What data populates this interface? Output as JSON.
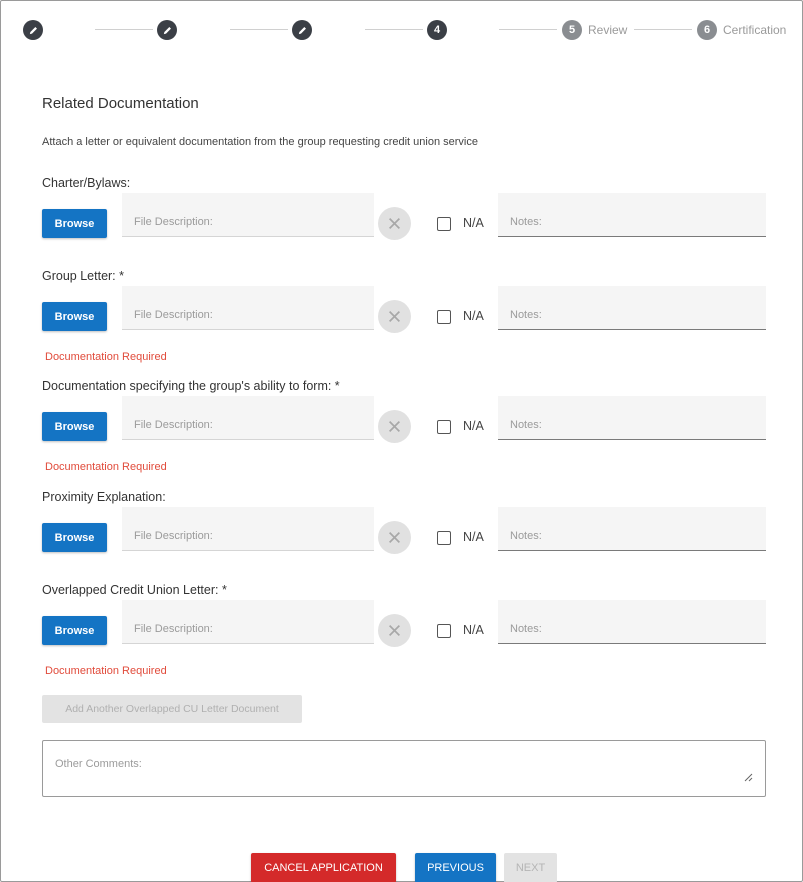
{
  "stepper": {
    "steps": [
      {
        "number": "",
        "label": "",
        "state": "completed",
        "icon": "pencil-icon"
      },
      {
        "number": "",
        "label": "",
        "state": "completed",
        "icon": "pencil-icon"
      },
      {
        "number": "",
        "label": "",
        "state": "completed",
        "icon": "pencil-icon"
      },
      {
        "number": "4",
        "label": "",
        "state": "current"
      },
      {
        "number": "5",
        "label": "Review",
        "state": "upcoming"
      },
      {
        "number": "6",
        "label": "Certification",
        "state": "upcoming"
      }
    ]
  },
  "section": {
    "title": "Related Documentation",
    "instruction": "Attach a letter or equivalent documentation from the group requesting credit union service"
  },
  "common": {
    "browse_label": "Browse",
    "file_desc_placeholder": "File Description:",
    "notes_placeholder": "Notes:",
    "na_label": "N/A",
    "clear_icon": "close-icon"
  },
  "documents": [
    {
      "label": "Charter/Bylaws:",
      "required": false,
      "error": ""
    },
    {
      "label": "Group Letter: *",
      "required": true,
      "error": "Documentation Required"
    },
    {
      "label": "Documentation specifying the group's ability to form: *",
      "required": true,
      "error": "Documentation Required"
    },
    {
      "label": "Proximity Explanation:",
      "required": false,
      "error": ""
    },
    {
      "label": "Overlapped Credit Union Letter: *",
      "required": true,
      "error": "Documentation Required"
    }
  ],
  "add_document_label": "Add Another Overlapped CU Letter Document",
  "comments_placeholder": "Other Comments:",
  "footer": {
    "cancel_label": "CANCEL APPLICATION",
    "previous_label": "PREVIOUS",
    "next_label": "NEXT"
  },
  "colors": {
    "primary": "#1474c4",
    "danger": "#d42a2a",
    "error_text": "#e14b3b",
    "step_active": "#3b3f46",
    "step_inactive": "#8a8d91"
  }
}
